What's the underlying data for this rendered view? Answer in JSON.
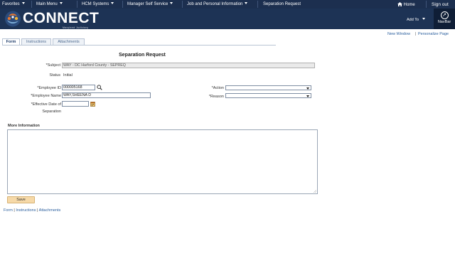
{
  "topbar": {
    "favorites": "Favorites",
    "main_menu": "Main Menu",
    "breadcrumb": {
      "hcm_systems": "HCM Systems",
      "manager_self_service": "Manager Self Service",
      "job_personal_info": "Job and Personal Information",
      "current": "Separation Request"
    },
    "home": "Home",
    "sign_out": "Sign out"
  },
  "header": {
    "logo_text": "CONNECT",
    "logo_sub": "Maryland Judiciary",
    "add_to": "Add To",
    "navbar": "NavBar"
  },
  "links": {
    "new_window": "New Window",
    "personalize_page": "Personalize Page"
  },
  "tabs": [
    {
      "label": "Form",
      "active": true
    },
    {
      "label": "Instructions",
      "active": false
    },
    {
      "label": "Attachments",
      "active": false
    }
  ],
  "form": {
    "title": "Separation Request",
    "subject_label": "*Subject",
    "subject_value": "WAY - DC Harford County - SEPREQ",
    "status_label": "Status",
    "status_value": "Initial",
    "employee_id_label": "*Employee ID",
    "employee_id_value": "000005168",
    "employee_name_label": "*Employee Name",
    "employee_name_value": "WAY,SHEENA D",
    "effective_date_label_1": "*Effective Date of",
    "effective_date_label_2": "Separation",
    "effective_date_value": "",
    "action_label": "*Action",
    "action_value": "",
    "reason_label": "*Reason",
    "reason_value": "",
    "more_info_label": "More Information",
    "more_info_value": "",
    "save_label": "Save"
  },
  "bottom_links": {
    "form": "Form",
    "instructions": "Instructions",
    "attachments": "Attachments",
    "separator": "|"
  },
  "colors": {
    "topbar": "#1c2f4f",
    "header": "#1d3355",
    "link": "#2b5f9e",
    "save_button": "#f6d9a8"
  }
}
